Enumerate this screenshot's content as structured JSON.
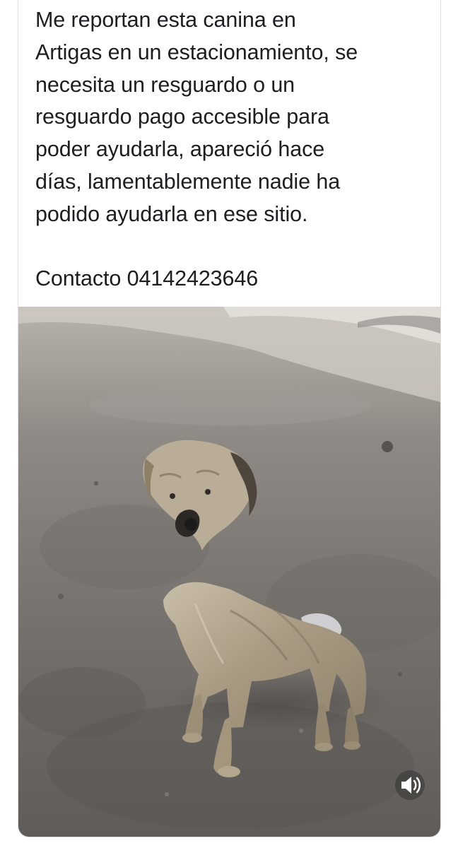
{
  "post": {
    "text_lines": [
      "Me reportan esta canina en",
      "Artigas en un estacionamiento, se",
      "necesita un resguardo o un",
      "resguardo pago accesible para",
      "poder ayudarla, apareció hace",
      "días, lamentablemente nadie ha",
      "podido ayudarla en ese sitio."
    ],
    "contact_line": "Contacto 04142423646"
  },
  "media": {
    "kind": "video",
    "subject": "dog-photo",
    "sound_icon": "speaker-volume-icon"
  }
}
